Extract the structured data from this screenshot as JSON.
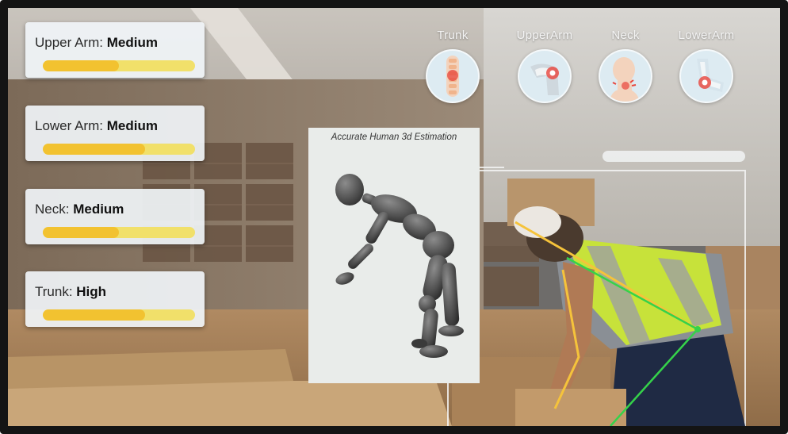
{
  "ratings": [
    {
      "label": "Upper Arm:",
      "level": "Medium",
      "fill": 0.5
    },
    {
      "label": "Lower Arm:",
      "level": "Medium",
      "fill": 0.67
    },
    {
      "label": "Neck:",
      "level": "Medium",
      "fill": 0.5
    },
    {
      "label": "Trunk:",
      "level": "High",
      "fill": 0.67
    }
  ],
  "body_parts": [
    {
      "label": "Trunk",
      "icon": "spine-icon"
    },
    {
      "label": "UpperArm",
      "icon": "shoulder-icon"
    },
    {
      "label": "Neck",
      "icon": "neck-icon"
    },
    {
      "label": "LowerArm",
      "icon": "elbow-icon"
    }
  ],
  "estimation_panel": {
    "title": "Accurate Human 3d Estimation"
  },
  "colors": {
    "bar_fill": "#f2c230",
    "bar_track": "#f1e06a",
    "pose_yellow": "#f5c33b",
    "pose_green": "#35d24a",
    "pain_red": "#e8453c",
    "icon_bg": "#ddebf2"
  }
}
